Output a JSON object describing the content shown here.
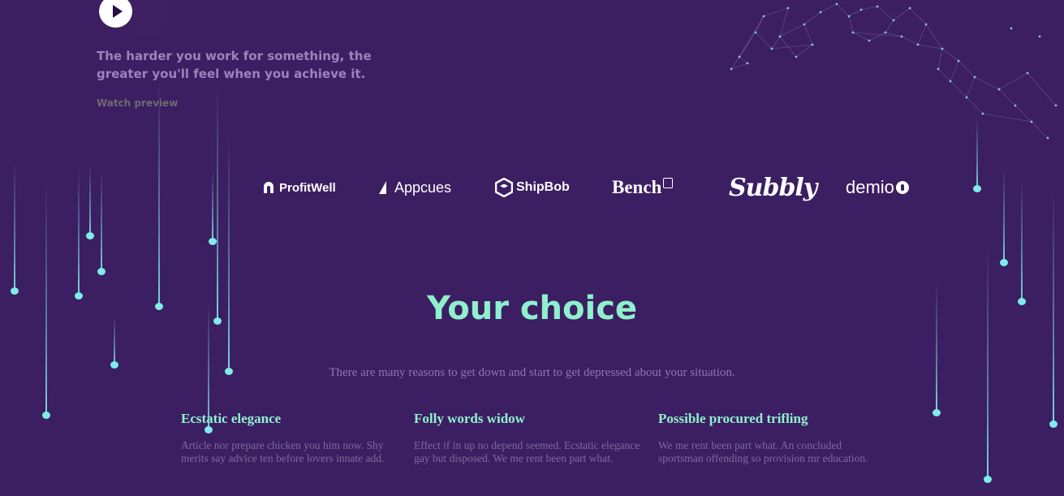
{
  "hero": {
    "quote": "The harder you work for something, the greater you'll feel when you achieve it.",
    "watch_link": "Watch preview",
    "play_icon": "play-icon"
  },
  "logos": [
    {
      "name": "ProfitWell",
      "icon": "profitwell-logo"
    },
    {
      "name": "Appcues",
      "icon": "appcues-logo"
    },
    {
      "name": "ShipBob",
      "icon": "shipbob-logo"
    },
    {
      "name": "Bench",
      "icon": "bench-logo"
    },
    {
      "name": "Subbly",
      "icon": "subbly-logo"
    },
    {
      "name": "demio",
      "icon": "demio-logo"
    }
  ],
  "section": {
    "title": "Your choice",
    "subtitle": "There are many reasons to get down and start to get depressed about your situation."
  },
  "features": [
    {
      "title": "Ecstatic elegance",
      "text": "Article nor prepare chicken you him now. Shy merits say advice ten before lovers innate add."
    },
    {
      "title": "Folly words widow",
      "text": "Effect if in up no depend seemed. Ecstatic elegance gay but disposed. We me rent been part what."
    },
    {
      "title": "Possible procured trifling",
      "text": "We me rent been part what. An concluded sportsman offending so provision mr education."
    }
  ],
  "colors": {
    "background": "#3c1e62",
    "accent": "#8ff0cd",
    "drop": "#7eece9"
  }
}
